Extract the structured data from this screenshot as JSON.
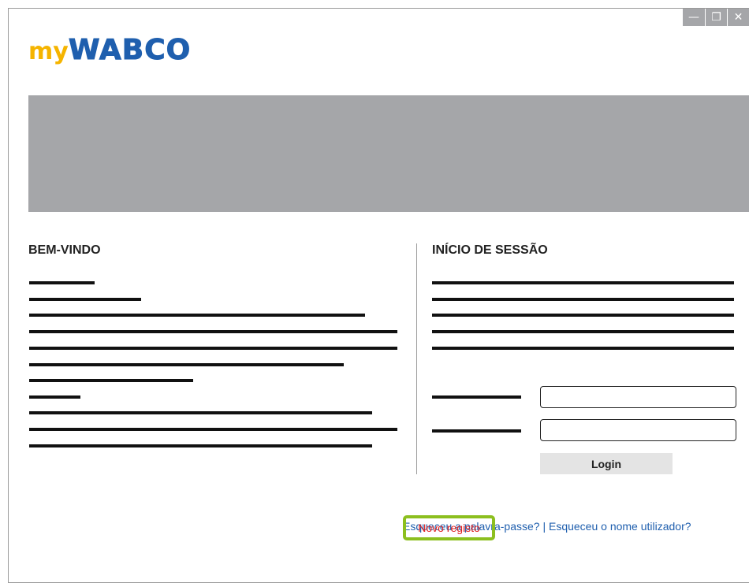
{
  "window": {
    "controls": {
      "minimize": "—",
      "restore": "❐",
      "close": "✕"
    }
  },
  "logo": {
    "my": "my",
    "brand": "WABCO",
    "my_color": "#f5b400",
    "brand_color": "#1f5fae"
  },
  "welcome": {
    "heading": "BEM-VINDO"
  },
  "session": {
    "heading": "INÍCIO DE SESSÃO",
    "login_label": "Login",
    "forgot_password": "Esqueceu a palavra-passe?",
    "separator": "|",
    "forgot_username": "Esqueceu o nome utilizador?",
    "new_registration": "Novo registo",
    "highlight_color": "#8cbf1f",
    "link_color": "#1f5fae",
    "register_color": "#e02020"
  }
}
